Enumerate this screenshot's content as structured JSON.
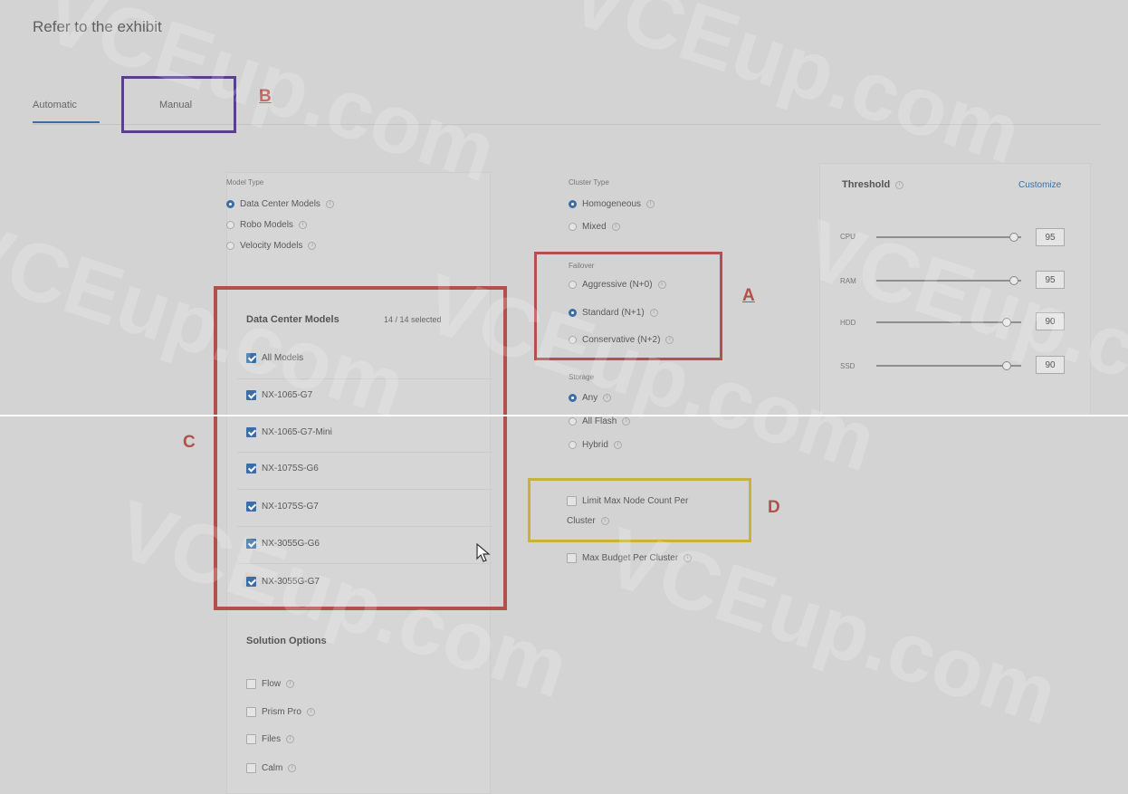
{
  "header": {
    "text": "Refer to the exhibit"
  },
  "tabs": [
    {
      "label": "Automatic",
      "active": true
    },
    {
      "label": "Manual",
      "active": false
    }
  ],
  "model_type": {
    "label": "Model Type",
    "options": [
      {
        "label": "Data Center Models",
        "selected": true
      },
      {
        "label": "Robo Models",
        "selected": false
      },
      {
        "label": "Velocity Models",
        "selected": false
      }
    ]
  },
  "data_center_models": {
    "title": "Data Center Models",
    "count": "14 / 14 selected",
    "items": [
      {
        "label": "All Models",
        "checked": true
      },
      {
        "label": "NX-1065-G7",
        "checked": true
      },
      {
        "label": "NX-1065-G7-Mini",
        "checked": true
      },
      {
        "label": "NX-1075S-G6",
        "checked": true
      },
      {
        "label": "NX-1075S-G7",
        "checked": true
      },
      {
        "label": "NX-3055G-G6",
        "checked": true
      },
      {
        "label": "NX-3055G-G7",
        "checked": true
      }
    ]
  },
  "solution_options": {
    "title": "Solution Options",
    "items": [
      {
        "label": "Flow",
        "checked": false
      },
      {
        "label": "Prism Pro",
        "checked": false
      },
      {
        "label": "Files",
        "checked": false
      },
      {
        "label": "Calm",
        "checked": false
      }
    ]
  },
  "cluster_type": {
    "label": "Cluster Type",
    "options": [
      {
        "label": "Homogeneous",
        "selected": true
      },
      {
        "label": "Mixed",
        "selected": false
      }
    ]
  },
  "failover": {
    "label": "Failover",
    "options": [
      {
        "label": "Aggressive (N+0)",
        "selected": false
      },
      {
        "label": "Standard (N+1)",
        "selected": true
      },
      {
        "label": "Conservative (N+2)",
        "selected": false
      }
    ]
  },
  "storage": {
    "label": "Storage",
    "options": [
      {
        "label": "Any",
        "selected": true
      },
      {
        "label": "All Flash",
        "selected": false
      },
      {
        "label": "Hybrid",
        "selected": false
      }
    ]
  },
  "limits": {
    "max_node_line1": "Limit Max Node Count Per",
    "max_node_line2": "Cluster",
    "max_budget": "Max Budget Per Cluster"
  },
  "threshold": {
    "title": "Threshold",
    "action": "Customize",
    "rows": [
      {
        "label": "CPU",
        "value": "95",
        "level": 0.95
      },
      {
        "label": "RAM",
        "value": "95",
        "level": 0.95
      },
      {
        "label": "HDD",
        "value": "90",
        "level": 0.9
      },
      {
        "label": "SSD",
        "value": "90",
        "level": 0.9
      }
    ]
  },
  "annotations": {
    "a": "A",
    "b": "B",
    "c": "C",
    "d": "D"
  },
  "watermark": "VCEup.com",
  "colors": {
    "accent": "#3a6ea5",
    "box_red": "#b0524a",
    "box_purple": "#5b3f8c",
    "box_yellow": "#c7b23a"
  }
}
